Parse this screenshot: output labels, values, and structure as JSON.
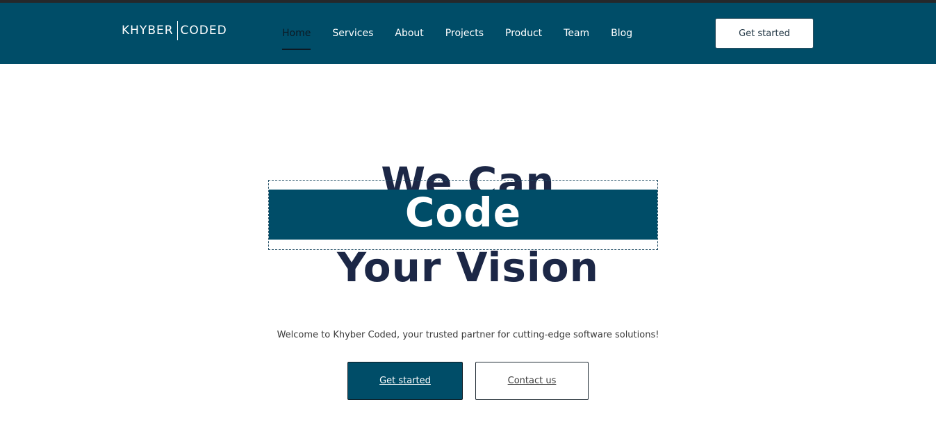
{
  "brand": {
    "logo_left": "KHYBER",
    "logo_right": "CODED"
  },
  "nav": {
    "items": [
      {
        "label": "Home",
        "active": true
      },
      {
        "label": "Services",
        "active": false
      },
      {
        "label": "About",
        "active": false
      },
      {
        "label": "Projects",
        "active": false
      },
      {
        "label": "Product",
        "active": false
      },
      {
        "label": "Team",
        "active": false
      },
      {
        "label": "Blog",
        "active": false
      }
    ]
  },
  "header": {
    "cta_label": "Get started"
  },
  "hero": {
    "line1": "We Can",
    "line2": "Code",
    "line3": "Your Vision",
    "subtitle": "Welcome to Khyber Coded, your trusted partner for cutting-edge software solutions!",
    "primary_label": "Get started",
    "secondary_label": "Contact us"
  },
  "colors": {
    "header_bg": "#004d68",
    "heading_text": "#1c2746",
    "band_bg": "#004d68",
    "top_strip": "#25282b"
  }
}
